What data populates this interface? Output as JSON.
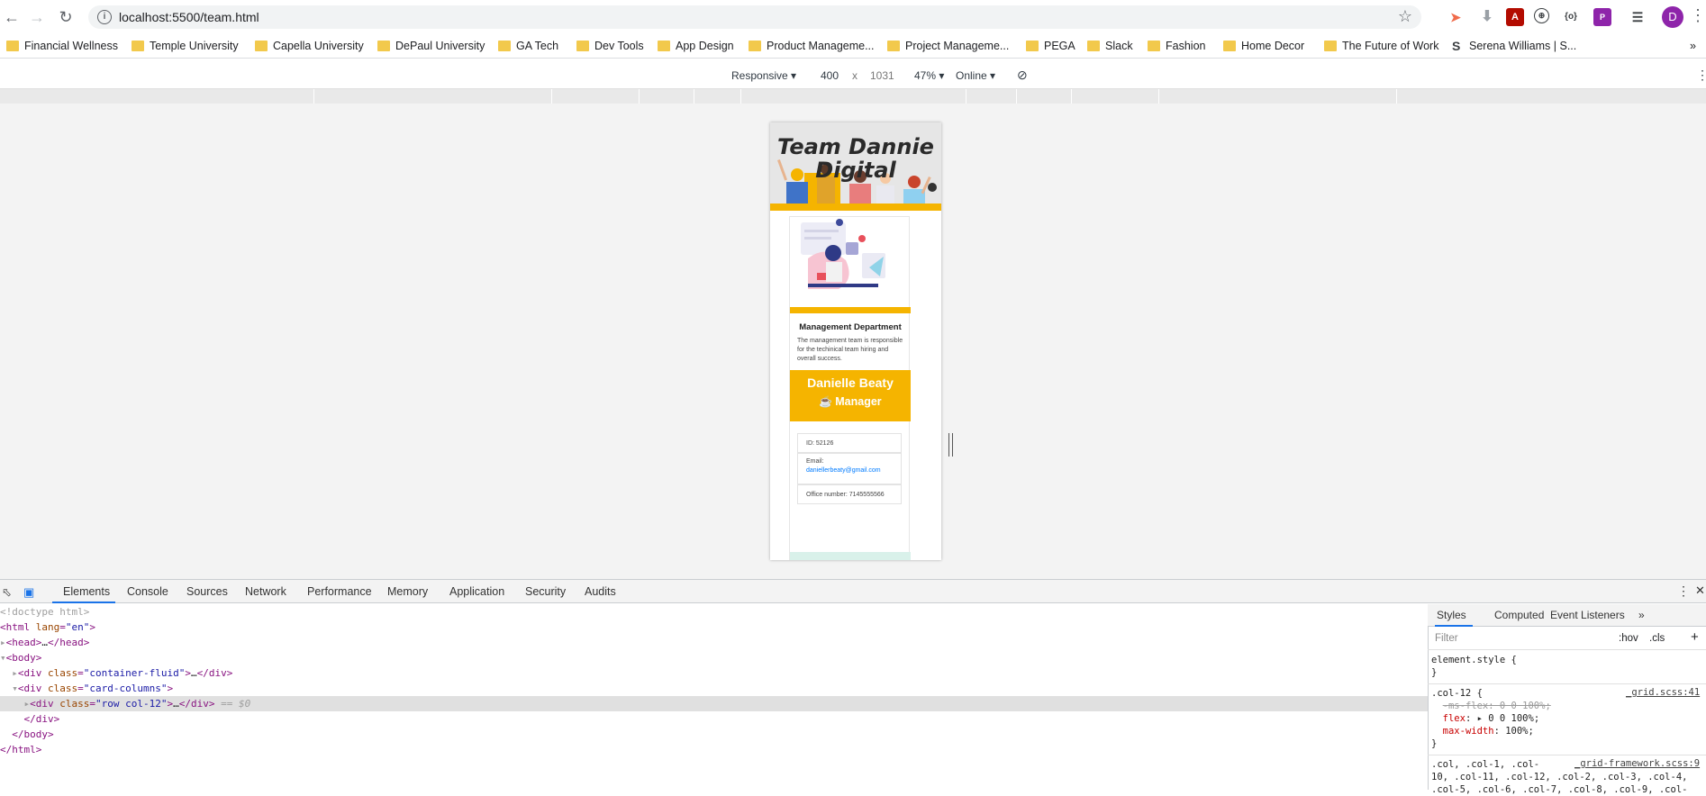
{
  "browser": {
    "url": "localhost:5500/team.html",
    "profile_initial": "D"
  },
  "bookmarks": [
    {
      "label": "Financial Wellness",
      "icon": "folder-icon"
    },
    {
      "label": "Temple University",
      "icon": "folder-icon"
    },
    {
      "label": "Capella University",
      "icon": "folder-icon"
    },
    {
      "label": "DePaul University",
      "icon": "folder-icon"
    },
    {
      "label": "GA Tech",
      "icon": "folder-icon"
    },
    {
      "label": "Dev Tools",
      "icon": "folder-icon"
    },
    {
      "label": "App Design",
      "icon": "folder-icon"
    },
    {
      "label": "Product Manageme...",
      "icon": "folder-icon"
    },
    {
      "label": "Project Manageme...",
      "icon": "folder-icon"
    },
    {
      "label": "PEGA",
      "icon": "folder-icon"
    },
    {
      "label": "Slack",
      "icon": "folder-icon"
    },
    {
      "label": "Fashion",
      "icon": "folder-icon"
    },
    {
      "label": "Home Decor",
      "icon": "folder-icon"
    },
    {
      "label": "The Future of Work",
      "icon": "folder-icon"
    },
    {
      "label": "Serena Williams | S...",
      "icon": "serena-s-icon"
    }
  ],
  "device_toolbar": {
    "device": "Responsive",
    "width": "400",
    "times": "x",
    "height": "1031",
    "zoom": "47%",
    "network": "Online"
  },
  "page": {
    "hero_title": "Team Dannie Digital",
    "card_title": "Management Department",
    "card_text": "The management team is responsible for the techinical team hiring and overall success.",
    "manager_name": "Danielle Beaty",
    "manager_role": "Manager",
    "id_text": "ID: 52126",
    "email_label": "Email:",
    "email_value": "daniellerbeaty@gmail.com",
    "office_text": "Office number: 7145555566"
  },
  "devtools": {
    "tabs": [
      "Elements",
      "Console",
      "Sources",
      "Network",
      "Performance",
      "Memory",
      "Application",
      "Security",
      "Audits"
    ],
    "active_tab": "Elements",
    "dom": {
      "doctype": "<!doctype html>",
      "html_open_tag": "html",
      "html_attr": "lang",
      "html_attr_val": "\"en\"",
      "head": "head",
      "body": "body",
      "div1_class": "\"container-fluid\"",
      "div2_class": "\"card-columns\"",
      "div3_class": "\"row col-12\"",
      "ellipsis": "…",
      "sel_marker": "== $0",
      "class_attr": "class",
      "div_tag": "div",
      "html_close": "html",
      "body_close": "body",
      "div_close": "div"
    },
    "styles_tabs": [
      "Styles",
      "Computed",
      "Event Listeners"
    ],
    "filter_placeholder": "Filter",
    "hov": ":hov",
    "cls": ".cls",
    "rules": {
      "element_style": "element.style {",
      "close": "}",
      "col12_selector": ".col-12 {",
      "col12_src": "_grid.scss:41",
      "ms_flex": "-ms-flex: 0 0 100%;",
      "flex_name": "flex",
      "flex_val": "0 0 100%;",
      "maxw_name": "max-width",
      "maxw_val": "100%;",
      "grid_selector": ".col, .col-1, .col-",
      "grid_src": "_grid-framework.scss:9",
      "grid_line2": "10, .col-11, .col-12, .col-2, .col-3, .col-4,",
      "grid_line3": ".col-5, .col-6, .col-7, .col-8, .col-9, .col-"
    }
  }
}
